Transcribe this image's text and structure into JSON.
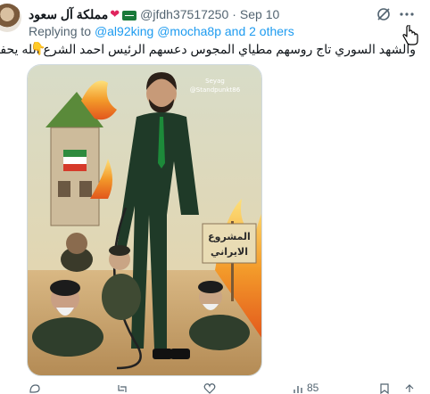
{
  "tweet": {
    "display_name": "مملكة آل سعود",
    "handle": "@jfdh37517250",
    "separator": "·",
    "date": "Sep 10",
    "replying_prefix": "Replying to ",
    "replying_users": "@al92king @mocha8p and 2 others",
    "text": "والشهد السوري تاج روسهم مطياي المجوس دعسهم الرئيس احمد الشرع الله يحفظه",
    "emoji": "👇"
  },
  "media": {
    "watermark_line1": "@Standpunkt86",
    "watermark_line2": "Seyag",
    "sign_line1": "المشروع",
    "sign_line2": "الايراني"
  },
  "actions": {
    "view_count": "85"
  },
  "colors": {
    "link": "#1d9bf0",
    "secondary_text": "#536471",
    "heart": "#e0245e"
  }
}
